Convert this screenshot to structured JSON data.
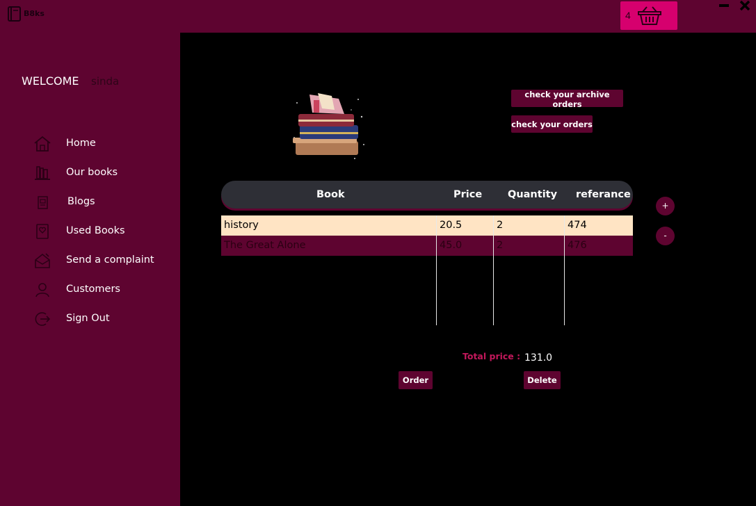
{
  "titlebar": {
    "app_name": "B8ks",
    "cart_count": "4"
  },
  "sidebar": {
    "welcome": "WELCOME",
    "username": "sinda",
    "items": [
      {
        "label": "Home",
        "icon": "home-icon"
      },
      {
        "label": "Our books",
        "icon": "bookshelf-icon"
      },
      {
        "label": "Blogs",
        "icon": "blog-icon"
      },
      {
        "label": "Used Books",
        "icon": "used-book-icon"
      },
      {
        "label": "Send a complaint",
        "icon": "complaint-icon"
      },
      {
        "label": "Customers",
        "icon": "customers-icon"
      },
      {
        "label": "Sign Out",
        "icon": "sign-out-icon"
      }
    ]
  },
  "main": {
    "archive_button": "check your archive orders",
    "orders_button": "check your orders",
    "plus_button": "+",
    "minus_button": "-",
    "table": {
      "headers": [
        "Book",
        "Price",
        "Quantity",
        "referance"
      ],
      "rows": [
        {
          "book": "history",
          "price": "20.5",
          "quantity": "2",
          "reference": "474"
        },
        {
          "book": "The Great Alone",
          "price": "45.0",
          "quantity": "2",
          "reference": "476"
        }
      ]
    },
    "total_label": "Total price :",
    "total_value": "131.0",
    "order_button": "Order",
    "delete_button": "Delete"
  },
  "colors": {
    "maroon": "#5e0430",
    "cart_pink": "#d6006e",
    "header_gray": "#2e2f36",
    "selected_row": "#ffe4c4",
    "total_label": "#c2185b"
  }
}
